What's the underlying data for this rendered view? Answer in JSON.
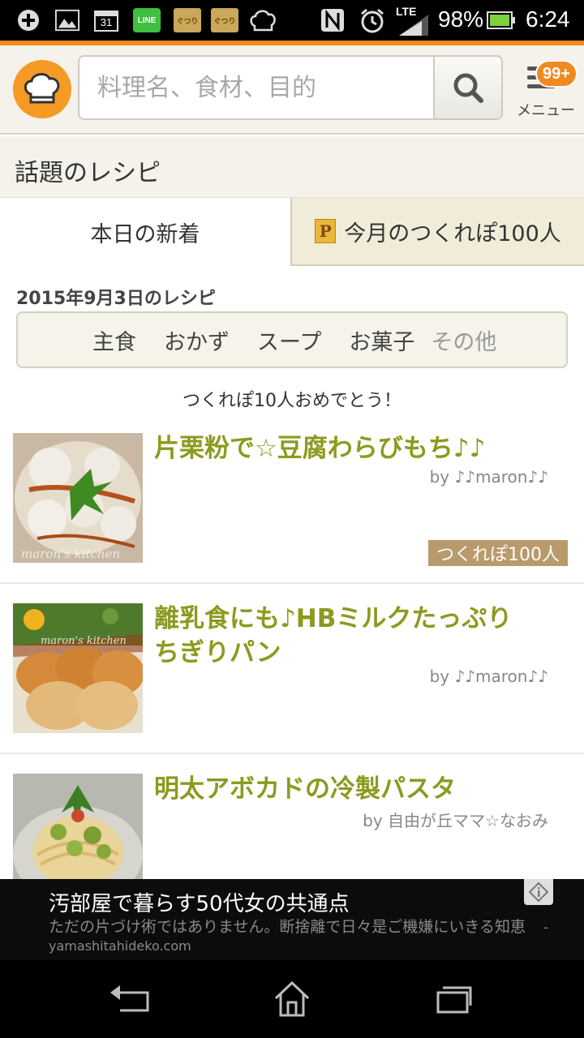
{
  "status_bar": {
    "battery": "98%",
    "time": "6:24",
    "network": "LTE",
    "calendar_day": "31",
    "line_label": "LINE",
    "notif_label": "ぐつり"
  },
  "header": {
    "search_placeholder": "料理名、食材、目的",
    "menu_badge": "99+",
    "menu_label": "メニュー"
  },
  "section": {
    "title": "話題のレシピ"
  },
  "tabs": [
    {
      "label": "本日の新着"
    },
    {
      "label": "今月のつくれぽ100人",
      "icon_text": "P"
    }
  ],
  "date_label": "2015年9月3日のレシピ",
  "categories": [
    "主食",
    "おかず",
    "スープ",
    "お菓子",
    "その他"
  ],
  "congrats": "つくれぽ10人おめでとう！",
  "recipes": [
    {
      "title": "片栗粉で☆豆腐わらびもち♪♪",
      "author": "by ♪♪maron♪♪",
      "tag": "つくれぽ100人",
      "watermark": "maron's kitchen"
    },
    {
      "title": "離乳食にも♪HBミルクたっぷりちぎりパン",
      "author": "by ♪♪maron♪♪",
      "watermark": "maron's kitchen"
    },
    {
      "title": "明太アボカドの冷製パスタ",
      "author": "by 自由が丘ママ☆なおみ"
    }
  ],
  "ad": {
    "title": "汚部屋で暮らす50代女の共通点",
    "text": "ただの片づけ術ではありません。断捨離で日々是ご機嫌にいきる知恵",
    "domain": "- yamashitahideko.com"
  },
  "colors": {
    "accent": "#f08a1f",
    "recipe_title": "#8c9a1e",
    "tag_bg": "#b99a6b",
    "header_bg": "#f4f2ea"
  }
}
